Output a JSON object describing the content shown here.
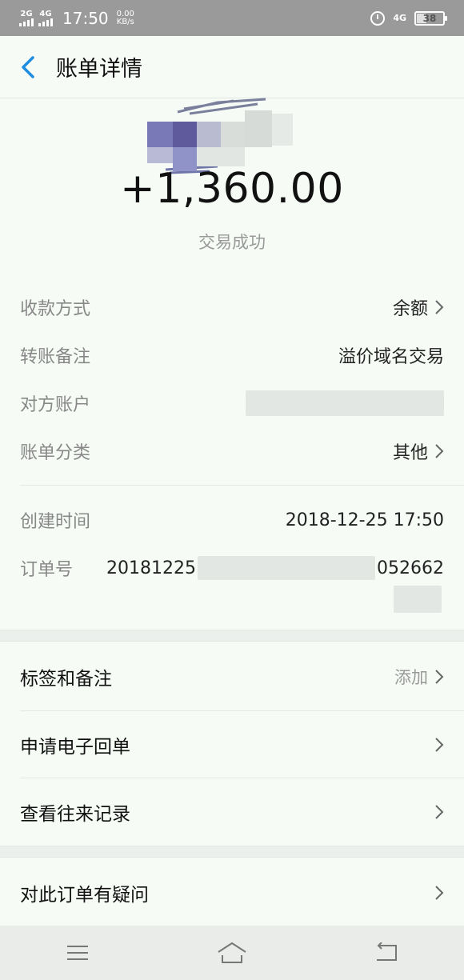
{
  "status_bar": {
    "net1": "2G",
    "net2": "4G",
    "time": "17:50",
    "speed_value": "0.00",
    "speed_unit": "KB/s",
    "network_type": "4G",
    "battery": "38",
    "battery_percent": 38
  },
  "nav": {
    "title": "账单详情"
  },
  "summary": {
    "amount": "+1,360.00",
    "status": "交易成功"
  },
  "details": [
    {
      "label": "收款方式",
      "value": "余额"
    },
    {
      "label": "转账备注",
      "value": "溢价域名交易"
    },
    {
      "label": "对方账户",
      "value": ""
    },
    {
      "label": "账单分类",
      "value": "其他"
    },
    {
      "label": "创建时间",
      "value": "2018-12-25 17:50"
    },
    {
      "label": "订单号",
      "value_prefix": "20181225",
      "value_suffix": "052662"
    }
  ],
  "actions": [
    {
      "label": "标签和备注",
      "value": "添加"
    },
    {
      "label": "申请电子回单",
      "value": ""
    },
    {
      "label": "查看往来记录",
      "value": ""
    },
    {
      "label": "对此订单有疑问",
      "value": ""
    }
  ],
  "colors": {
    "accent": "#1f8ee0",
    "background": "#f6fbf6",
    "status_bar": "#9a9a9a"
  }
}
